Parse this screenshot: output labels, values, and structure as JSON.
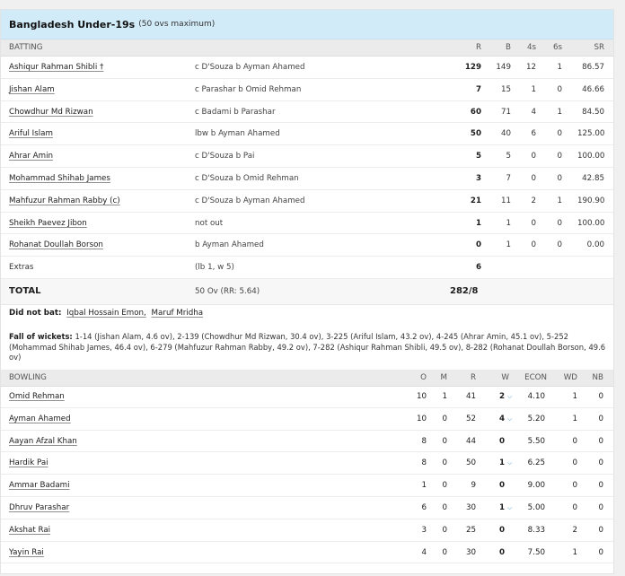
{
  "header": {
    "team": "Bangladesh Under-19s",
    "overs_note": "(50 ovs maximum)"
  },
  "batting": {
    "headers": {
      "title": "BATTING",
      "r": "R",
      "b": "B",
      "fours": "4s",
      "sixes": "6s",
      "sr": "SR"
    },
    "rows": [
      {
        "name": "Ashiqur Rahman Shibli †",
        "dismissal": "c D'Souza b Ayman Ahamed",
        "r": "129",
        "b": "149",
        "fours": "12",
        "sixes": "1",
        "sr": "86.57"
      },
      {
        "name": "Jishan Alam",
        "dismissal": "c Parashar b Omid Rehman",
        "r": "7",
        "b": "15",
        "fours": "1",
        "sixes": "0",
        "sr": "46.66"
      },
      {
        "name": "Chowdhur Md Rizwan",
        "dismissal": "c Badami b Parashar",
        "r": "60",
        "b": "71",
        "fours": "4",
        "sixes": "1",
        "sr": "84.50"
      },
      {
        "name": "Ariful Islam",
        "dismissal": "lbw b Ayman Ahamed",
        "r": "50",
        "b": "40",
        "fours": "6",
        "sixes": "0",
        "sr": "125.00"
      },
      {
        "name": "Ahrar Amin",
        "dismissal": "c D'Souza b Pai",
        "r": "5",
        "b": "5",
        "fours": "0",
        "sixes": "0",
        "sr": "100.00"
      },
      {
        "name": "Mohammad Shihab James",
        "dismissal": "c D'Souza b Omid Rehman",
        "r": "3",
        "b": "7",
        "fours": "0",
        "sixes": "0",
        "sr": "42.85"
      },
      {
        "name": "Mahfuzur Rahman Rabby (c)",
        "dismissal": "c D'Souza b Ayman Ahamed",
        "r": "21",
        "b": "11",
        "fours": "2",
        "sixes": "1",
        "sr": "190.90"
      },
      {
        "name": "Sheikh Paevez Jibon",
        "dismissal": "not out",
        "r": "1",
        "b": "1",
        "fours": "0",
        "sixes": "0",
        "sr": "100.00"
      },
      {
        "name": "Rohanat Doullah Borson",
        "dismissal": "b Ayman Ahamed",
        "r": "0",
        "b": "1",
        "fours": "0",
        "sixes": "0",
        "sr": "0.00"
      }
    ],
    "extras": {
      "label": "Extras",
      "detail": "(lb 1, w 5)",
      "value": "6"
    },
    "total": {
      "label": "TOTAL",
      "overs": "50 Ov (RR: 5.64)",
      "score": "282/8"
    }
  },
  "did_not_bat": {
    "label": "Did not bat:",
    "players": [
      "Iqbal Hossain Emon,",
      "Maruf Mridha"
    ]
  },
  "fall_of_wickets": {
    "label": "Fall of wickets:",
    "text": "1-14 (Jishan Alam, 4.6 ov), 2-139 (Chowdhur Md Rizwan, 30.4 ov), 3-225 (Ariful Islam, 43.2 ov), 4-245 (Ahrar Amin, 45.1 ov), 5-252 (Mohammad Shihab James, 46.4 ov), 6-279 (Mahfuzur Rahman Rabby, 49.2 ov), 7-282 (Ashiqur Rahman Shibli, 49.5 ov), 8-282 (Rohanat Doullah Borson, 49.6 ov)"
  },
  "bowling": {
    "headers": {
      "title": "BOWLING",
      "o": "O",
      "m": "M",
      "r": "R",
      "w": "W",
      "econ": "ECON",
      "wd": "WD",
      "nb": "NB"
    },
    "rows": [
      {
        "name": "Omid Rehman",
        "o": "10",
        "m": "1",
        "r": "41",
        "w": "2",
        "expand": true,
        "econ": "4.10",
        "wd": "1",
        "nb": "0"
      },
      {
        "name": "Ayman Ahamed",
        "o": "10",
        "m": "0",
        "r": "52",
        "w": "4",
        "expand": true,
        "econ": "5.20",
        "wd": "1",
        "nb": "0"
      },
      {
        "name": "Aayan Afzal Khan",
        "o": "8",
        "m": "0",
        "r": "44",
        "w": "0",
        "expand": false,
        "econ": "5.50",
        "wd": "0",
        "nb": "0"
      },
      {
        "name": "Hardik Pai",
        "o": "8",
        "m": "0",
        "r": "50",
        "w": "1",
        "expand": true,
        "econ": "6.25",
        "wd": "0",
        "nb": "0"
      },
      {
        "name": "Ammar Badami",
        "o": "1",
        "m": "0",
        "r": "9",
        "w": "0",
        "expand": false,
        "econ": "9.00",
        "wd": "0",
        "nb": "0"
      },
      {
        "name": "Dhruv Parashar",
        "o": "6",
        "m": "0",
        "r": "30",
        "w": "1",
        "expand": true,
        "econ": "5.00",
        "wd": "0",
        "nb": "0"
      },
      {
        "name": "Akshat Rai",
        "o": "3",
        "m": "0",
        "r": "25",
        "w": "0",
        "expand": false,
        "econ": "8.33",
        "wd": "2",
        "nb": "0"
      },
      {
        "name": "Yayin Rai",
        "o": "4",
        "m": "0",
        "r": "30",
        "w": "0",
        "expand": false,
        "econ": "7.50",
        "wd": "1",
        "nb": "0"
      }
    ]
  },
  "icons": {
    "expand": "chevron-down-icon"
  },
  "colors": {
    "header_bg": "#d2ebf8",
    "accent": "#2c8fc9"
  }
}
